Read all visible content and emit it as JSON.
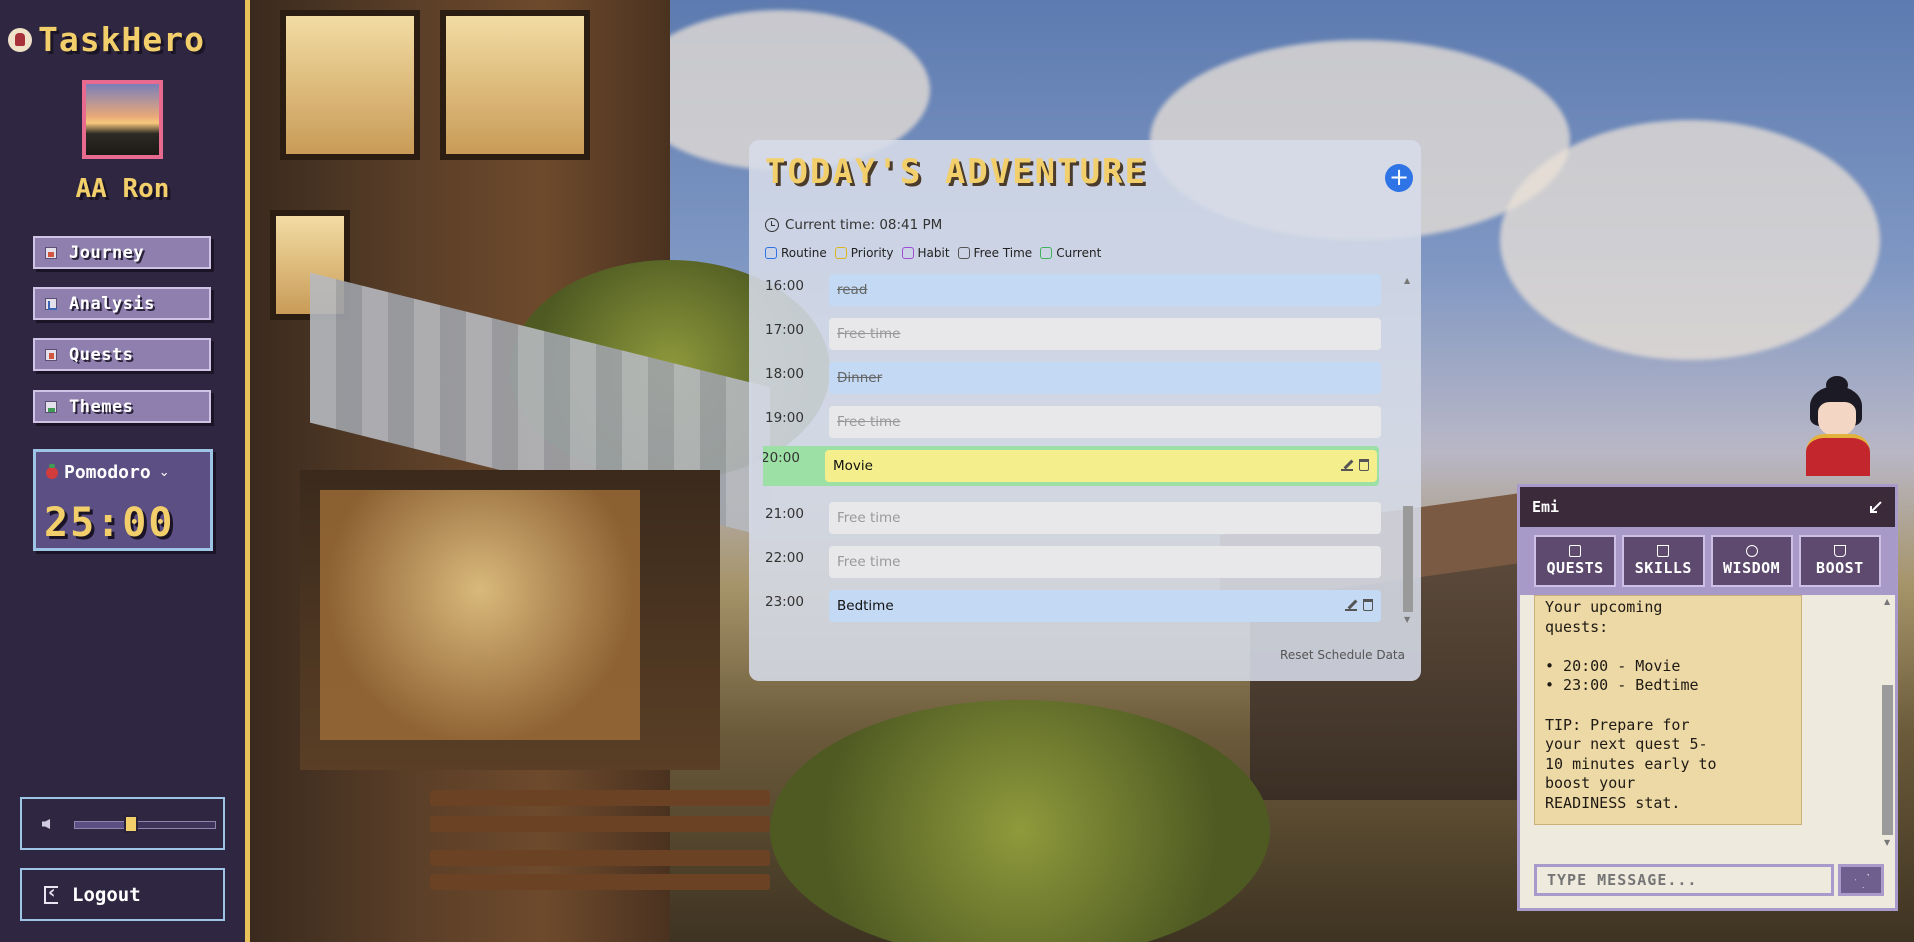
{
  "app": {
    "title": "TaskHero"
  },
  "user": {
    "name": "AA Ron"
  },
  "nav": [
    {
      "label": "Journey",
      "icon": "journey-icon"
    },
    {
      "label": "Analysis",
      "icon": "analysis-icon"
    },
    {
      "label": "Quests",
      "icon": "quests-icon"
    },
    {
      "label": "Themes",
      "icon": "themes-icon"
    }
  ],
  "pomodoro": {
    "label": "Pomodoro",
    "time": "25:00"
  },
  "volume": {
    "level": 0.4
  },
  "logout": {
    "label": "Logout"
  },
  "schedule": {
    "title": "TODAY'S ADVENTURE",
    "add_label": "+",
    "current_time": "Current time: 08:41 PM",
    "legend": [
      {
        "label": "Routine",
        "color": "#2f74e6"
      },
      {
        "label": "Priority",
        "color": "#d9b620"
      },
      {
        "label": "Habit",
        "color": "#a04bd6"
      },
      {
        "label": "Free Time",
        "color": "#555555"
      },
      {
        "label": "Current",
        "color": "#3fb35b"
      }
    ],
    "rows": [
      {
        "time": "16:00",
        "label": "read",
        "type": "routine",
        "done": true,
        "current": false,
        "actions": false
      },
      {
        "time": "17:00",
        "label": "Free time",
        "type": "free",
        "done": true,
        "current": false,
        "actions": false
      },
      {
        "time": "18:00",
        "label": "Dinner",
        "type": "routine",
        "done": true,
        "current": false,
        "actions": false
      },
      {
        "time": "19:00",
        "label": "Free time",
        "type": "free",
        "done": true,
        "current": false,
        "actions": false
      },
      {
        "time": "20:00",
        "label": "Movie",
        "type": "priority",
        "done": false,
        "current": true,
        "actions": true
      },
      {
        "time": "21:00",
        "label": "Free time",
        "type": "free",
        "done": false,
        "current": false,
        "actions": false
      },
      {
        "time": "22:00",
        "label": "Free time",
        "type": "free",
        "done": false,
        "current": false,
        "actions": false
      },
      {
        "time": "23:00",
        "label": "Bedtime",
        "type": "routine",
        "done": false,
        "current": false,
        "actions": true
      }
    ],
    "reset_label": "Reset Schedule Data",
    "colors": {
      "routine": "#c3d9f4",
      "free": "#e8e8ea",
      "priority": "#f4ef8c",
      "current": "#9ce0a6"
    }
  },
  "chat": {
    "name": "Emi",
    "tabs": [
      {
        "label": "QUESTS",
        "icon": "calendar-icon"
      },
      {
        "label": "SKILLS",
        "icon": "book-icon"
      },
      {
        "label": "WISDOM",
        "icon": "clock-icon"
      },
      {
        "label": "BOOST",
        "icon": "coffee-icon"
      }
    ],
    "message": "Your upcoming\nquests:\n\n• 20:00 - Movie\n• 23:00 - Bedtime\n\nTIP: Prepare for\nyour next quest 5-\n10 minutes early to\nboost your\nREADINESS stat.",
    "input_placeholder": "TYPE MESSAGE..."
  }
}
